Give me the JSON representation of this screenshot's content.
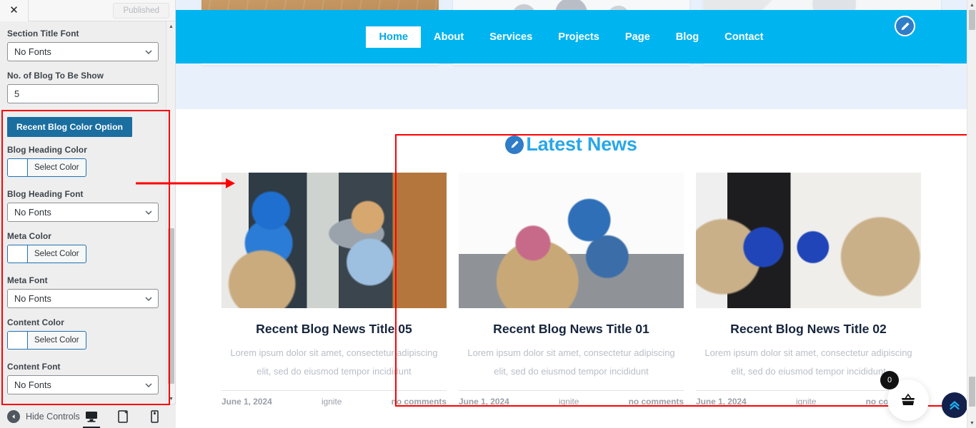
{
  "colors": {
    "nav_blue": "#00b4f0",
    "heading_blue": "#29a7e8",
    "button_blue": "#1a6ea0",
    "highlight_red": "#ff0000",
    "card_title": "#16253c",
    "to_top_navy": "#13204c"
  },
  "sidebar": {
    "close_label": "✕",
    "published_label": "Published",
    "controls": [
      {
        "type": "select",
        "label": "Section Title Font",
        "value": "No Fonts"
      },
      {
        "type": "text",
        "label": "No. of Blog To Be Show",
        "value": "5"
      },
      {
        "type": "button",
        "label": "Recent Blog Color Option"
      },
      {
        "type": "color",
        "label": "Blog Heading Color",
        "value": "Select Color"
      },
      {
        "type": "select",
        "label": "Blog Heading Font",
        "value": "No Fonts"
      },
      {
        "type": "color",
        "label": "Meta Color",
        "value": "Select Color"
      },
      {
        "type": "select",
        "label": "Meta Font",
        "value": "No Fonts"
      },
      {
        "type": "color",
        "label": "Content Color",
        "value": "Select Color"
      },
      {
        "type": "select",
        "label": "Content Font",
        "value": "No Fonts"
      }
    ],
    "footer": {
      "hide_controls_label": "Hide Controls",
      "devices": [
        {
          "name": "desktop",
          "active": true
        },
        {
          "name": "tablet",
          "active": false
        },
        {
          "name": "mobile",
          "active": false
        }
      ]
    }
  },
  "preview": {
    "nav": {
      "items": [
        {
          "label": "Home",
          "active": true
        },
        {
          "label": "About",
          "active": false
        },
        {
          "label": "Services",
          "active": false
        },
        {
          "label": "Projects",
          "active": false
        },
        {
          "label": "Page",
          "active": false
        },
        {
          "label": "Blog",
          "active": false
        },
        {
          "label": "Contact",
          "active": false
        }
      ]
    },
    "news": {
      "title": "Latest News",
      "cards": [
        {
          "title": "Recent Blog News Title 05",
          "excerpt": "Lorem ipsum dolor sit amet, consectetur adipiscing elit, sed do eiusmod tempor incididunt",
          "date": "June 1, 2024",
          "author": "ignite",
          "comments": "no comments",
          "image": "delivery-man-handing-package"
        },
        {
          "title": "Recent Blog News Title 01",
          "excerpt": "Lorem ipsum dolor sit amet, consectetur adipiscing elit, sed do eiusmod tempor incididunt",
          "date": "June 1, 2024",
          "author": "ignite",
          "comments": "no comments",
          "image": "family-playing-with-moving-box"
        },
        {
          "title": "Recent Blog News Title 02",
          "excerpt": "Lorem ipsum dolor sit amet, consectetur adipiscing elit, sed do eiusmod tempor incididunt",
          "date": "June 1, 2024",
          "author": "ignite",
          "comments": "no comments",
          "image": "two-movers-sitting-with-boxes"
        }
      ]
    },
    "widgets": {
      "cart_count": "0"
    }
  }
}
